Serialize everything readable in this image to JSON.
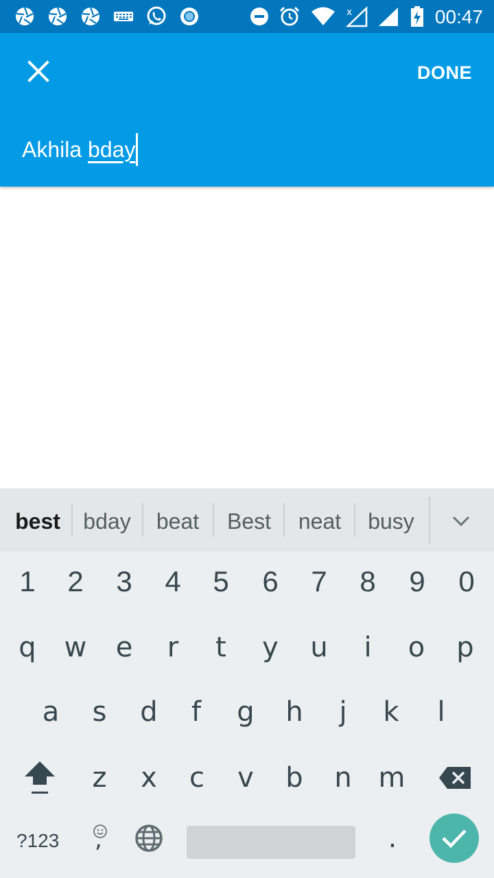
{
  "status_bar": {
    "time": "00:47",
    "icons_left": [
      "aperture-icon",
      "aperture-icon",
      "aperture-icon",
      "keyboard-icon",
      "whatsapp-icon",
      "record-icon"
    ],
    "icons_right": [
      "do-not-disturb-icon",
      "alarm-icon",
      "wifi-icon",
      "no-signal-icon",
      "signal-icon",
      "battery-charging-icon"
    ],
    "color": "#0277bd"
  },
  "app_bar": {
    "color": "#039be5",
    "close_icon": "close-icon",
    "done_label": "DONE",
    "title_prefix": "Akhila ",
    "title_current_word": "bday"
  },
  "keyboard": {
    "suggestions": [
      "best",
      "bday",
      "beat",
      "Best",
      "neat",
      "busy"
    ],
    "expand_icon": "chevron-down-icon",
    "number_row": [
      "1",
      "2",
      "3",
      "4",
      "5",
      "6",
      "7",
      "8",
      "9",
      "0"
    ],
    "row1": [
      "q",
      "w",
      "e",
      "r",
      "t",
      "y",
      "u",
      "i",
      "o",
      "p"
    ],
    "row2": [
      "a",
      "s",
      "d",
      "f",
      "g",
      "h",
      "j",
      "k",
      "l"
    ],
    "row3": [
      "z",
      "x",
      "c",
      "v",
      "b",
      "n",
      "m"
    ],
    "symbols_label": "?123",
    "comma_label": ",",
    "period_label": ".",
    "enter_color": "#4db6ac"
  }
}
